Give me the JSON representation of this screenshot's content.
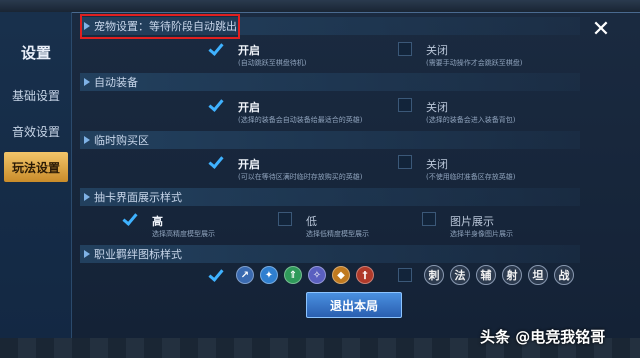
{
  "sidebar": {
    "title": "设置",
    "items": [
      {
        "label": "基础设置"
      },
      {
        "label": "音效设置"
      },
      {
        "label": "玩法设置"
      }
    ]
  },
  "sections": [
    {
      "title": "宠物设置：等待阶段自动跳出",
      "options": [
        {
          "label": "开启",
          "sub": "(自动跳跃至棋盘待机)",
          "checked": true
        },
        {
          "label": "关闭",
          "sub": "(需要手动操作才会跳跃至棋盘)",
          "checked": false
        }
      ]
    },
    {
      "title": "自动装备",
      "options": [
        {
          "label": "开启",
          "sub": "(选择的装备会自动装备给最适合的英雄)",
          "checked": true
        },
        {
          "label": "关闭",
          "sub": "(选择的装备会进入装备背包)",
          "checked": false
        }
      ]
    },
    {
      "title": "临时购买区",
      "options": [
        {
          "label": "开启",
          "sub": "(可以在等待区满时临时存放购买的英雄)",
          "checked": true
        },
        {
          "label": "关闭",
          "sub": "(不使用临时准备区存放英雄)",
          "checked": false
        }
      ]
    },
    {
      "title": "抽卡界面展示样式",
      "options": [
        {
          "label": "高",
          "sub": "选择高精度模型展示",
          "checked": true
        },
        {
          "label": "低",
          "sub": "选择低精度模型展示",
          "checked": false
        },
        {
          "label": "图片展示",
          "sub": "选择半身像图片展示",
          "checked": false
        }
      ]
    },
    {
      "title": "职业羁绊图标样式",
      "icon_set": [
        "assassin-icon",
        "mage-icon",
        "ranger-icon",
        "support-icon",
        "tank-icon",
        "warrior-icon"
      ],
      "text_set": [
        "刺",
        "法",
        "辅",
        "射",
        "坦",
        "战"
      ]
    }
  ],
  "exit_button": "退出本局",
  "watermark": "头条 @电竞我铭哥",
  "colors": {
    "accent": "#3fb2ff",
    "active_tab": "#e2a840",
    "highlight": "#e02020"
  }
}
